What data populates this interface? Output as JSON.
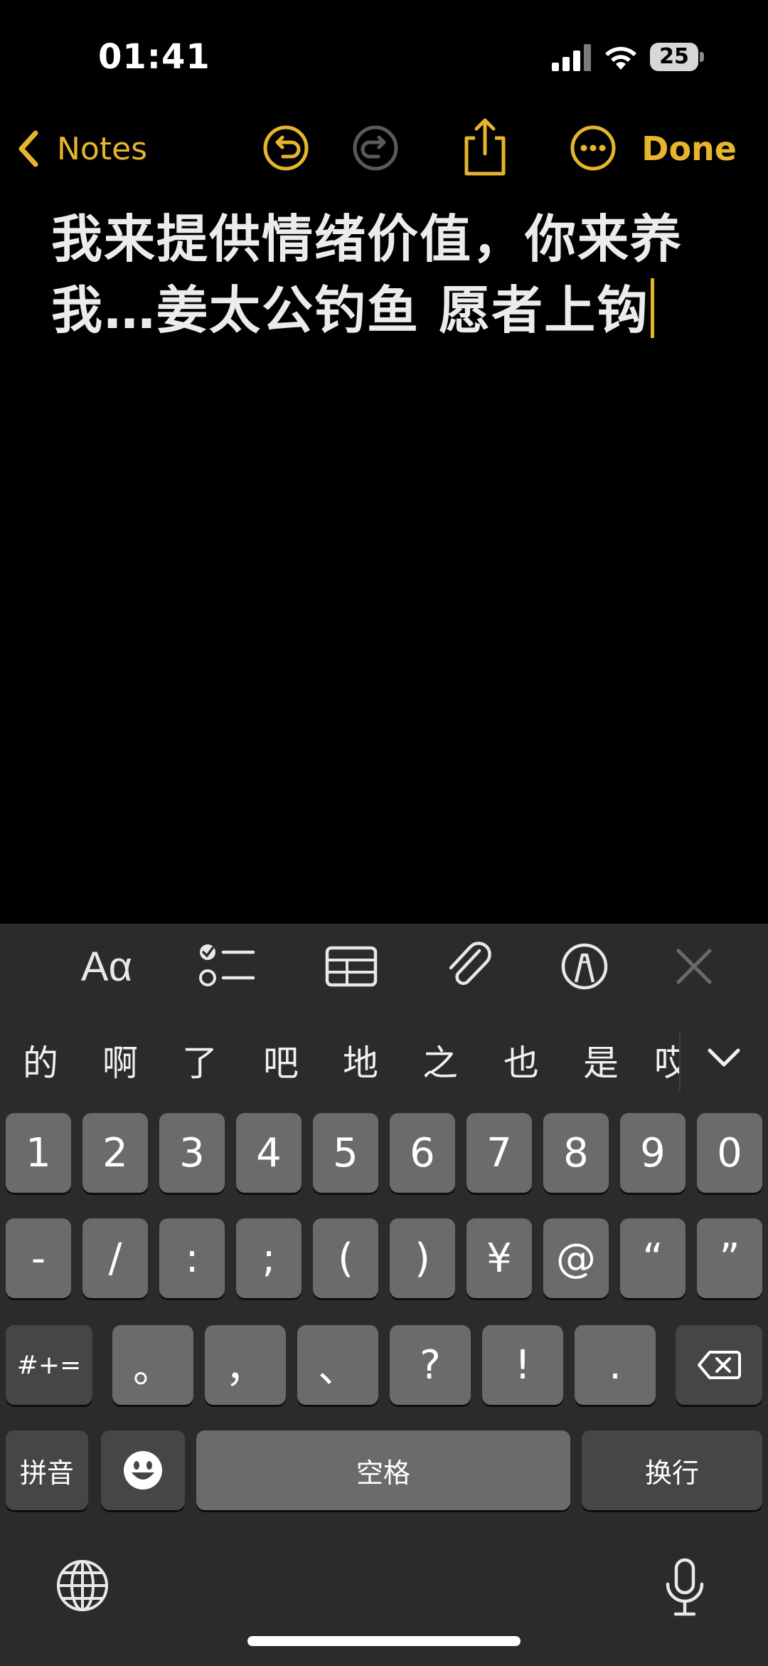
{
  "status_bar": {
    "time": "01:41",
    "battery_level": "25",
    "signal_icon": "cellular-signal-icon",
    "wifi_icon": "wifi-icon"
  },
  "nav": {
    "back_label": "Notes",
    "done_label": "Done",
    "accent_color": "#e6b52c",
    "icons": [
      "chevron-left-icon",
      "undo-icon",
      "redo-icon",
      "share-icon",
      "more-icon"
    ]
  },
  "note": {
    "line1": "我来提供情绪价值，你来养",
    "line2": "我…姜太公钓鱼 愿者上钩"
  },
  "format_toolbar": {
    "text_style_label": "Aα",
    "icons": [
      "checklist-icon",
      "table-icon",
      "paperclip-icon",
      "markup-pen-icon",
      "close-icon"
    ]
  },
  "keyboard": {
    "candidates": [
      "的",
      "啊",
      "了",
      "吧",
      "地",
      "之",
      "也",
      "是",
      "哎"
    ],
    "row1": [
      "1",
      "2",
      "3",
      "4",
      "5",
      "6",
      "7",
      "8",
      "9",
      "0"
    ],
    "row2": [
      "-",
      "/",
      ":",
      ";",
      "(",
      ")",
      "¥",
      "@",
      "“",
      "”"
    ],
    "row3": {
      "shift_label": "#+=",
      "keys": [
        "。",
        "，",
        "、",
        "?",
        "!",
        "."
      ]
    },
    "row4": {
      "mode_label": "拼音",
      "space_label": "空格",
      "return_label": "换行"
    },
    "key_color": "#6b6b6b",
    "dark_key_color": "#464646"
  }
}
